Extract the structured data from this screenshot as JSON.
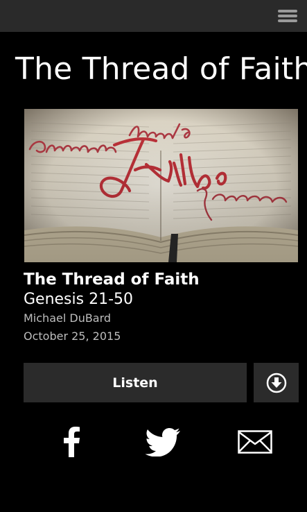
{
  "header": {
    "menu_icon": "hamburger-menu-icon"
  },
  "page": {
    "title": "The Thread of Faith"
  },
  "hero_image": {
    "words": [
      "Genesis",
      "thread of",
      "Faith",
      "Rawlston"
    ]
  },
  "sermon": {
    "series_title": "The Thread of Faith",
    "passage": "Genesis 21-50",
    "speaker": "Michael DuBard",
    "date": "October 25, 2015"
  },
  "actions": {
    "listen_label": "Listen",
    "download_icon": "download-circle-icon"
  },
  "share": {
    "facebook_icon": "facebook-icon",
    "twitter_icon": "twitter-icon",
    "email_icon": "email-icon"
  },
  "colors": {
    "background": "#000000",
    "topbar": "#2a2a2a",
    "button": "#2b2b2b",
    "accent_red": "#c0323a"
  }
}
